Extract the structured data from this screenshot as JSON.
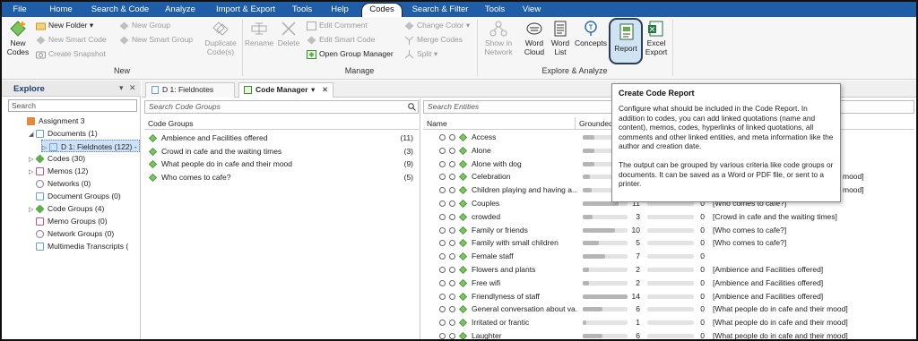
{
  "menu": {
    "tabs": [
      "File",
      "Home",
      "Search & Code",
      "Analyze",
      "Import & Export",
      "Tools",
      "Help",
      "Codes",
      "Search & Filter",
      "Tools",
      "View"
    ],
    "active": "Codes"
  },
  "ribbon": {
    "new_code": "New Codes",
    "new_folder": "New Folder",
    "new_smart_code": "New Smart Code",
    "create_snapshot": "Create Snapshot",
    "new_group": "New Group",
    "new_smart_group": "New Smart Group",
    "duplicate_codes": "Duplicate Code(s)",
    "group_new_label": "New",
    "rename": "Rename",
    "delete": "Delete",
    "edit_comment": "Edit Comment",
    "edit_smart_code": "Edit Smart Code",
    "open_group_manager": "Open Group Manager",
    "change_color": "Change Color",
    "merge_codes": "Merge Codes",
    "split": "Split",
    "group_manage_label": "Manage",
    "show_in_network": "Show in Network",
    "word_cloud": "Word Cloud",
    "word_list": "Word List",
    "concepts": "Concepts",
    "report": "Report",
    "excel_export": "Excel Export",
    "group_explore_label": "Explore & Analyze"
  },
  "explore": {
    "title": "Explore",
    "search_placeholder": "Search",
    "tree": [
      {
        "label": "Assignment 3",
        "color": "#e28a3a"
      },
      {
        "label": "Documents (1)",
        "color": "#6aa0d8"
      },
      {
        "label": "D 1: Fieldnotes (122) -",
        "color": "#6aa0d8"
      },
      {
        "label": "Codes (30)",
        "color": "#5fb04a"
      },
      {
        "label": "Memos (12)",
        "color": "#c9547d"
      },
      {
        "label": "Networks (0)",
        "color": "#8a6cc8"
      },
      {
        "label": "Document Groups (0)",
        "color": "#6aa0d8"
      },
      {
        "label": "Code Groups (4)",
        "color": "#5fb04a"
      },
      {
        "label": "Memo Groups (0)",
        "color": "#c9547d"
      },
      {
        "label": "Network Groups (0)",
        "color": "#8a6cc8"
      },
      {
        "label": "Multimedia Transcripts (",
        "color": "#6aa0d8"
      }
    ]
  },
  "doc_tabs": {
    "tab1": "D 1: Fieldnotes",
    "tab2": "Code Manager"
  },
  "code_groups": {
    "search_placeholder": "Search Code Groups",
    "header": "Code Groups",
    "rows": [
      {
        "name": "Ambience and Facilities offered",
        "count": "(11)"
      },
      {
        "name": "Crowd in cafe and the waiting times",
        "count": "(3)"
      },
      {
        "name": "What people do in cafe and their mood",
        "count": "(9)"
      },
      {
        "name": "Who comes to cafe?",
        "count": "(5)"
      }
    ]
  },
  "entities": {
    "search_placeholder": "Search Entities",
    "col_name": "Name",
    "col_grounded": "Grounded",
    "rows": [
      {
        "name": "Access",
        "grounded": "",
        "density": "",
        "groups": "",
        "gfrac": 0.25
      },
      {
        "name": "Alone",
        "grounded": "",
        "density": "",
        "groups": "",
        "gfrac": 0.25
      },
      {
        "name": "Alone with dog",
        "grounded": "",
        "density": "",
        "groups": "",
        "gfrac": 0.25
      },
      {
        "name": "Celebration",
        "grounded": "",
        "density": "",
        "groups": "mood]",
        "gfrac": 0.15
      },
      {
        "name": "Children playing and having a...",
        "grounded": "",
        "density": "",
        "groups": "mood]",
        "gfrac": 0.2
      },
      {
        "name": "Couples",
        "grounded": "11",
        "density": "0",
        "groups": "[Who comes to cafe?]",
        "gfrac": 0.79
      },
      {
        "name": "crowded",
        "grounded": "3",
        "density": "0",
        "groups": "[Crowd in cafe and the waiting times]",
        "gfrac": 0.21
      },
      {
        "name": "Family or friends",
        "grounded": "10",
        "density": "0",
        "groups": "[Who comes to cafe?]",
        "gfrac": 0.71
      },
      {
        "name": "Family with small children",
        "grounded": "5",
        "density": "0",
        "groups": "[Who comes to cafe?]",
        "gfrac": 0.36
      },
      {
        "name": "Female staff",
        "grounded": "7",
        "density": "0",
        "groups": "",
        "gfrac": 0.5
      },
      {
        "name": "Flowers and plants",
        "grounded": "2",
        "density": "0",
        "groups": "[Ambience and Facilities offered]",
        "gfrac": 0.14
      },
      {
        "name": "Free wifi",
        "grounded": "2",
        "density": "0",
        "groups": "[Ambience and Facilities offered]",
        "gfrac": 0.14
      },
      {
        "name": "Friendlyness of staff",
        "grounded": "14",
        "density": "0",
        "groups": "[Ambience and Facilities offered]",
        "gfrac": 1.0
      },
      {
        "name": "General conversation about va...",
        "grounded": "6",
        "density": "0",
        "groups": "[What people do in cafe and their mood]",
        "gfrac": 0.43
      },
      {
        "name": "Irritated or frantic",
        "grounded": "1",
        "density": "0",
        "groups": "[What people do in cafe and their mood]",
        "gfrac": 0.07
      },
      {
        "name": "Laughter",
        "grounded": "6",
        "density": "0",
        "groups": "[What people do in cafe and their mood]",
        "gfrac": 0.43
      }
    ]
  },
  "tooltip": {
    "title": "Create Code Report",
    "p1": "Configure what should be included in the Code Report. In addition to codes, you can add linked quotations (name and content), memos, codes, hyperlinks of linked quotations, all comments and other linked entities, and meta information like the author and creation date.",
    "p2": "The output can be grouped by various criteria like code groups or documents. It can be saved as a Word or PDF file, or sent to a printer."
  },
  "colors": {
    "menubar": "#1f5ea6",
    "code_green": "#5fb04a",
    "report_highlight": "#cfe3f3"
  }
}
